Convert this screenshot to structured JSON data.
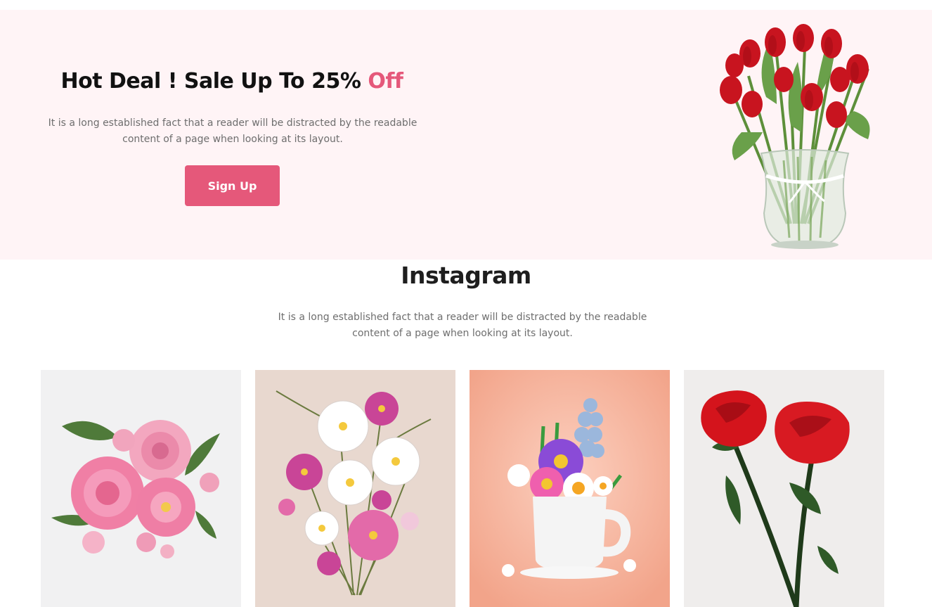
{
  "hero": {
    "title_main": "Hot Deal ! Sale Up To 25% ",
    "title_accent": "Off",
    "text": "It is a long established fact that a reader will be distracted by the readable content of a page when looking at its layout.",
    "button_label": "Sign Up",
    "image": "red-tulips-vase-image"
  },
  "instagram": {
    "title": "Instagram",
    "text": "It is a long established fact that a reader will be distracted by the readable content of a page when looking at its layout.",
    "tiles": [
      {
        "image": "pink-roses-image"
      },
      {
        "image": "cosmos-bouquet-image"
      },
      {
        "image": "flowers-in-mug-image"
      },
      {
        "image": "red-roses-image"
      }
    ]
  },
  "colors": {
    "accent": "#e5587a",
    "hero_background": "#fff4f6",
    "heading": "#111111",
    "body_text": "#6e6e6e"
  }
}
